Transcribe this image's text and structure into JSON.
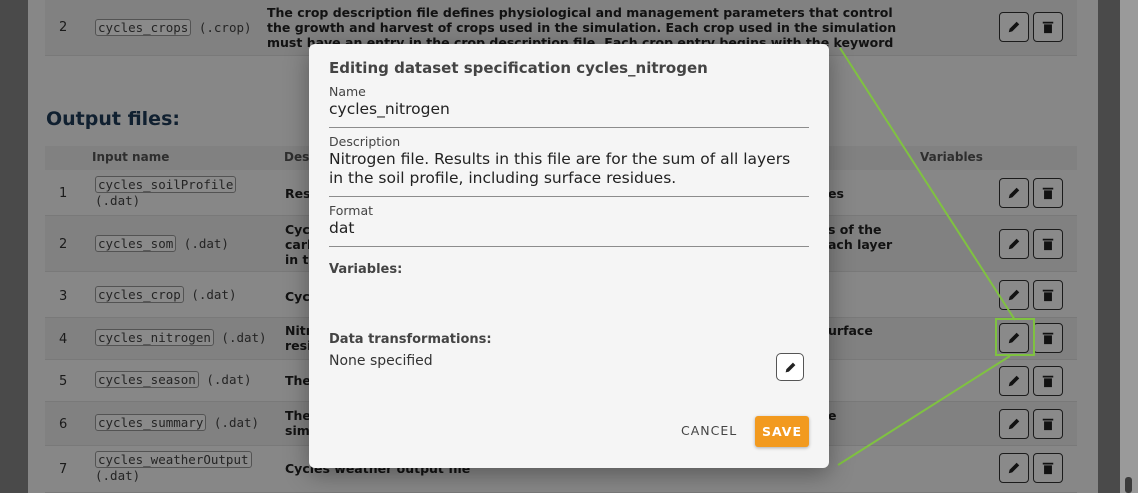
{
  "background": {
    "top_row": {
      "index": "2",
      "name": "cycles_crops",
      "ext": "(.crop)",
      "description": "The crop description file defines physiological and management parameters that control the growth and harvest of crops used in the simulation. Each crop used in the simulation must have an entry in the crop description file. Each crop entry begins with the keyword tag NAME."
    },
    "section_title": "Output files:",
    "columns": {
      "input_name": "Input name",
      "description": "Desc",
      "variables": "Variables"
    },
    "rows": [
      {
        "index": "1",
        "name": "cycles_soilProfile",
        "ext": "(.dat)",
        "desc_left": "Res",
        "desc_right": "es"
      },
      {
        "index": "2",
        "name": "cycles_som",
        "ext": "(.dat)",
        "desc_left": "Cyc\ncarb\nin th",
        "desc_right": "s of the\nach layer"
      },
      {
        "index": "3",
        "name": "cycles_crop",
        "ext": "(.dat)",
        "desc_left": "Cyc",
        "desc_right": ""
      },
      {
        "index": "4",
        "name": "cycles_nitrogen",
        "ext": "(.dat)",
        "desc_left": "Nitr\nresi",
        "desc_right": "urface"
      },
      {
        "index": "5",
        "name": "cycles_season",
        "ext": "(.dat)",
        "desc_left": "The",
        "desc_right": ""
      },
      {
        "index": "6",
        "name": "cycles_summary",
        "ext": "(.dat)",
        "desc_left": "The\nsim",
        "desc_right": "e"
      },
      {
        "index": "7",
        "name": "cycles_weatherOutput",
        "ext": "(.dat)",
        "desc_left": "Cycles weather output file",
        "desc_right": ""
      }
    ]
  },
  "modal": {
    "title": "Editing dataset specification cycles_nitrogen",
    "name_label": "Name",
    "name_value": "cycles_nitrogen",
    "description_label": "Description",
    "description_value": "Nitrogen file. Results in this file are for the sum of all layers in the soil profile, including surface residues.",
    "format_label": "Format",
    "format_value": "dat",
    "variables_label": "Variables:",
    "transformations_label": "Data transformations:",
    "transformations_value": "None specified",
    "cancel_label": "CANCEL",
    "save_label": "SAVE"
  },
  "icons": {
    "edit": "pencil-icon",
    "delete": "trash-icon"
  },
  "colors": {
    "accent": "#f29a1f",
    "highlight": "#7fc241",
    "heading": "#1f3b5a"
  }
}
